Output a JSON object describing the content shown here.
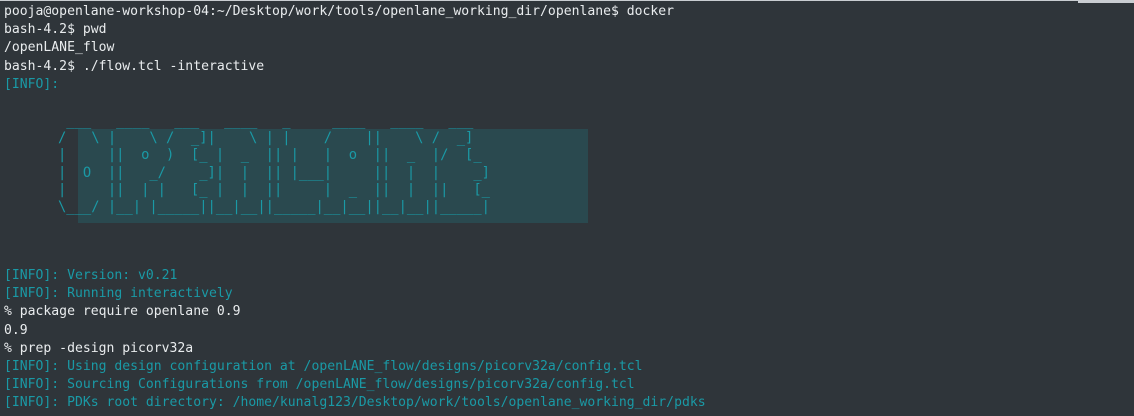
{
  "terminal": {
    "lines_top": [
      {
        "kind": "cmd",
        "text": "pooja@openlane-workshop-04:~/Desktop/work/tools/openlane_working_dir/openlane$ docker"
      },
      {
        "kind": "cmd",
        "text": "bash-4.2$ pwd"
      },
      {
        "kind": "out",
        "text": "/openLANE_flow"
      },
      {
        "kind": "cmd",
        "text": "bash-4.2$ ./flow.tcl -interactive"
      },
      {
        "kind": "info",
        "text": "[INFO]:"
      }
    ],
    "banner": " ___   ____   ___   ____   _     ____   ____   ___\n/   \\ |    \\ /  _]|    \\ | |    /    ||    \\ /  _]\n|     ||  o  )  [_ |  _  || |   |  o  ||  _  |/  [_\n|  O  ||   _/    _]|  |  || |___|     ||  |  |    _]\n|     ||  | |   [_ |  |  ||     |  _  ||  |  ||   [_\n\\___/ |__| |_____||__|__||_____|__|__||__|__||_____|",
    "lines_bottom": [
      {
        "kind": "info",
        "text": "[INFO]: Version: v0.21"
      },
      {
        "kind": "info",
        "text": "[INFO]: Running interactively"
      },
      {
        "kind": "cmd",
        "text": "% package require openlane 0.9"
      },
      {
        "kind": "out",
        "text": "0.9"
      },
      {
        "kind": "cmd",
        "text": "% prep -design picorv32a"
      },
      {
        "kind": "info",
        "text": "[INFO]: Using design configuration at /openLANE_flow/designs/picorv32a/config.tcl"
      },
      {
        "kind": "info",
        "text": "[INFO]: Sourcing Configurations from /openLANE_flow/designs/picorv32a/config.tcl"
      },
      {
        "kind": "info",
        "text": "[INFO]: PDKs root directory: /home/kunalg123/Desktop/work/tools/openlane_working_dir/pdks"
      }
    ],
    "colors": {
      "background": "#2f353a",
      "text": "#e9ecee",
      "info": "#1a9aa6"
    }
  }
}
